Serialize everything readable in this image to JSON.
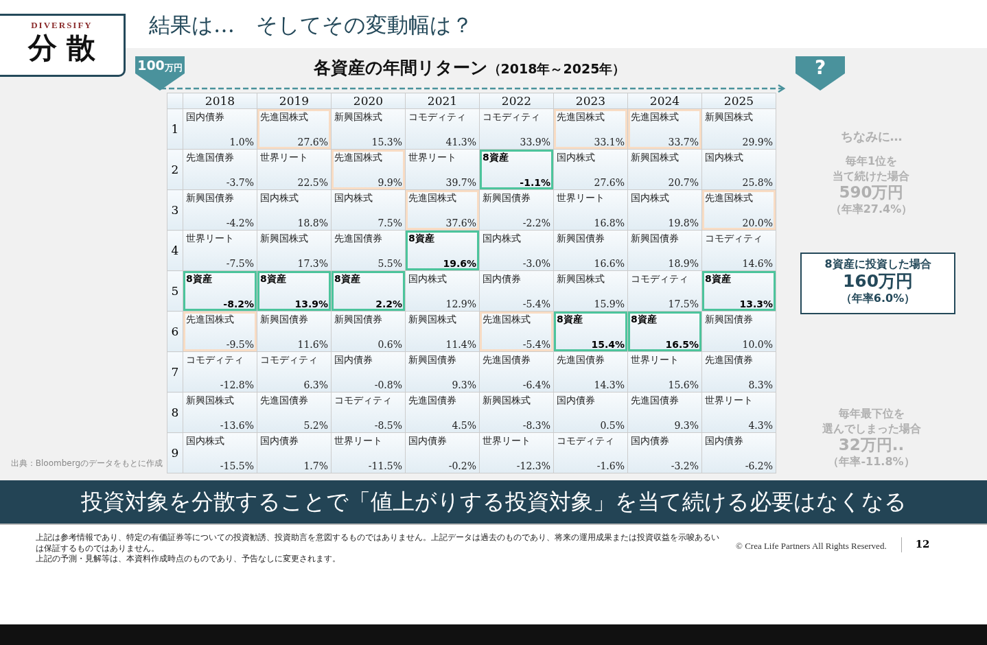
{
  "badge": {
    "label": "DIVERSIFY",
    "title": "分 散"
  },
  "heading": "結果は…　そしてその変動幅は？",
  "chart_title": {
    "main": "各資産の年間リターン",
    "period": "（2018年～2025年）"
  },
  "start_marker": {
    "amount": "100",
    "unit": "万円"
  },
  "end_marker": "?",
  "table": {
    "columns": [
      "2018",
      "2019",
      "2020",
      "2021",
      "2022",
      "2023",
      "2024",
      "2025"
    ],
    "rows": [
      {
        "rank": "1",
        "cells": [
          {
            "asset": "国内債券",
            "ret": "1.0%",
            "kind": "asset"
          },
          {
            "asset": "先進国株式",
            "ret": "27.6%",
            "kind": "developed"
          },
          {
            "asset": "新興国株式",
            "ret": "15.3%",
            "kind": "asset"
          },
          {
            "asset": "コモディティ",
            "ret": "41.3%",
            "kind": "asset"
          },
          {
            "asset": "コモディティ",
            "ret": "33.9%",
            "kind": "asset"
          },
          {
            "asset": "先進国株式",
            "ret": "33.1%",
            "kind": "developed"
          },
          {
            "asset": "先進国株式",
            "ret": "33.7%",
            "kind": "developed"
          },
          {
            "asset": "新興国株式",
            "ret": "29.9%",
            "kind": "asset"
          }
        ]
      },
      {
        "rank": "2",
        "cells": [
          {
            "asset": "先進国債券",
            "ret": "-3.7%",
            "kind": "asset"
          },
          {
            "asset": "世界リート",
            "ret": "22.5%",
            "kind": "asset"
          },
          {
            "asset": "先進国株式",
            "ret": "9.9%",
            "kind": "developed"
          },
          {
            "asset": "世界リート",
            "ret": "39.7%",
            "kind": "asset"
          },
          {
            "asset": "8資産",
            "ret": "-1.1%",
            "kind": "portfolio"
          },
          {
            "asset": "国内株式",
            "ret": "27.6%",
            "kind": "asset"
          },
          {
            "asset": "新興国株式",
            "ret": "20.7%",
            "kind": "asset"
          },
          {
            "asset": "国内株式",
            "ret": "25.8%",
            "kind": "asset"
          }
        ]
      },
      {
        "rank": "3",
        "cells": [
          {
            "asset": "新興国債券",
            "ret": "-4.2%",
            "kind": "asset"
          },
          {
            "asset": "国内株式",
            "ret": "18.8%",
            "kind": "asset"
          },
          {
            "asset": "国内株式",
            "ret": "7.5%",
            "kind": "asset"
          },
          {
            "asset": "先進国株式",
            "ret": "37.6%",
            "kind": "developed"
          },
          {
            "asset": "新興国債券",
            "ret": "-2.2%",
            "kind": "asset"
          },
          {
            "asset": "世界リート",
            "ret": "16.8%",
            "kind": "asset"
          },
          {
            "asset": "国内株式",
            "ret": "19.8%",
            "kind": "asset"
          },
          {
            "asset": "先進国株式",
            "ret": "20.0%",
            "kind": "developed"
          }
        ]
      },
      {
        "rank": "4",
        "cells": [
          {
            "asset": "世界リート",
            "ret": "-7.5%",
            "kind": "asset"
          },
          {
            "asset": "新興国株式",
            "ret": "17.3%",
            "kind": "asset"
          },
          {
            "asset": "先進国債券",
            "ret": "5.5%",
            "kind": "asset"
          },
          {
            "asset": "8資産",
            "ret": "19.6%",
            "kind": "portfolio"
          },
          {
            "asset": "国内株式",
            "ret": "-3.0%",
            "kind": "asset"
          },
          {
            "asset": "新興国債券",
            "ret": "16.6%",
            "kind": "asset"
          },
          {
            "asset": "新興国債券",
            "ret": "18.9%",
            "kind": "asset"
          },
          {
            "asset": "コモディティ",
            "ret": "14.6%",
            "kind": "asset"
          }
        ]
      },
      {
        "rank": "5",
        "cells": [
          {
            "asset": "8資産",
            "ret": "-8.2%",
            "kind": "portfolio"
          },
          {
            "asset": "8資産",
            "ret": "13.9%",
            "kind": "portfolio"
          },
          {
            "asset": "8資産",
            "ret": "2.2%",
            "kind": "portfolio"
          },
          {
            "asset": "国内株式",
            "ret": "12.9%",
            "kind": "asset"
          },
          {
            "asset": "国内債券",
            "ret": "-5.4%",
            "kind": "asset"
          },
          {
            "asset": "新興国株式",
            "ret": "15.9%",
            "kind": "asset"
          },
          {
            "asset": "コモディティ",
            "ret": "17.5%",
            "kind": "asset"
          },
          {
            "asset": "8資産",
            "ret": "13.3%",
            "kind": "portfolio"
          }
        ]
      },
      {
        "rank": "6",
        "cells": [
          {
            "asset": "先進国株式",
            "ret": "-9.5%",
            "kind": "developed"
          },
          {
            "asset": "新興国債券",
            "ret": "11.6%",
            "kind": "asset"
          },
          {
            "asset": "新興国債券",
            "ret": "0.6%",
            "kind": "asset"
          },
          {
            "asset": "新興国株式",
            "ret": "11.4%",
            "kind": "asset"
          },
          {
            "asset": "先進国株式",
            "ret": "-5.4%",
            "kind": "developed"
          },
          {
            "asset": "8資産",
            "ret": "15.4%",
            "kind": "portfolio"
          },
          {
            "asset": "8資産",
            "ret": "16.5%",
            "kind": "portfolio"
          },
          {
            "asset": "新興国債券",
            "ret": "10.0%",
            "kind": "asset"
          }
        ]
      },
      {
        "rank": "7",
        "cells": [
          {
            "asset": "コモディティ",
            "ret": "-12.8%",
            "kind": "asset"
          },
          {
            "asset": "コモディティ",
            "ret": "6.3%",
            "kind": "asset"
          },
          {
            "asset": "国内債券",
            "ret": "-0.8%",
            "kind": "asset"
          },
          {
            "asset": "新興国債券",
            "ret": "9.3%",
            "kind": "asset"
          },
          {
            "asset": "先進国債券",
            "ret": "-6.4%",
            "kind": "asset"
          },
          {
            "asset": "先進国債券",
            "ret": "14.3%",
            "kind": "asset"
          },
          {
            "asset": "世界リート",
            "ret": "15.6%",
            "kind": "asset"
          },
          {
            "asset": "先進国債券",
            "ret": "8.3%",
            "kind": "asset"
          }
        ]
      },
      {
        "rank": "8",
        "cells": [
          {
            "asset": "新興国株式",
            "ret": "-13.6%",
            "kind": "asset"
          },
          {
            "asset": "先進国債券",
            "ret": "5.2%",
            "kind": "asset"
          },
          {
            "asset": "コモディティ",
            "ret": "-8.5%",
            "kind": "asset"
          },
          {
            "asset": "先進国債券",
            "ret": "4.5%",
            "kind": "asset"
          },
          {
            "asset": "新興国株式",
            "ret": "-8.3%",
            "kind": "asset"
          },
          {
            "asset": "国内債券",
            "ret": "0.5%",
            "kind": "asset"
          },
          {
            "asset": "先進国債券",
            "ret": "9.3%",
            "kind": "asset"
          },
          {
            "asset": "世界リート",
            "ret": "4.3%",
            "kind": "asset"
          }
        ]
      },
      {
        "rank": "9",
        "cells": [
          {
            "asset": "国内株式",
            "ret": "-15.5%",
            "kind": "asset"
          },
          {
            "asset": "国内債券",
            "ret": "1.7%",
            "kind": "asset"
          },
          {
            "asset": "世界リート",
            "ret": "-11.5%",
            "kind": "asset"
          },
          {
            "asset": "国内債券",
            "ret": "-0.2%",
            "kind": "asset"
          },
          {
            "asset": "世界リート",
            "ret": "-12.3%",
            "kind": "asset"
          },
          {
            "asset": "コモディティ",
            "ret": "-1.6%",
            "kind": "asset"
          },
          {
            "asset": "国内債券",
            "ret": "-3.2%",
            "kind": "asset"
          },
          {
            "asset": "国内債券",
            "ret": "-6.2%",
            "kind": "asset"
          }
        ]
      }
    ]
  },
  "source": "出典：Bloombergのデータをもとに作成",
  "aside": {
    "intro": "ちなみに…",
    "best": {
      "lines": [
        "毎年1位を",
        "当て続けた場合"
      ],
      "amount": "590万円",
      "rate": "（年率27.4%）"
    },
    "portfolio": {
      "lines": [
        "8資産に投資した場合"
      ],
      "amount": "160万円",
      "rate": "（年率6.0%）"
    },
    "worst": {
      "lines": [
        "毎年最下位を",
        "選んでしまった場合"
      ],
      "amount": "32万円..",
      "rate": "（年率-11.8%）"
    }
  },
  "banner": "投資対象を分散することで「値上がりする投資対象」を当て続ける必要はなくなる",
  "disclaimer": [
    "上記は参考情報であり、特定の有価証券等についての投資勧誘、投資助言を意図するものではありません。上記データは過去のものであり、将来の運用成果または投資収益を示唆あるいは保証するものではありません。",
    "上記の予測・見解等は、本資料作成時点のものであり、予告なしに変更されます。"
  ],
  "copyright": "© Crea Life Partners All Rights Reserved.",
  "page": "12"
}
